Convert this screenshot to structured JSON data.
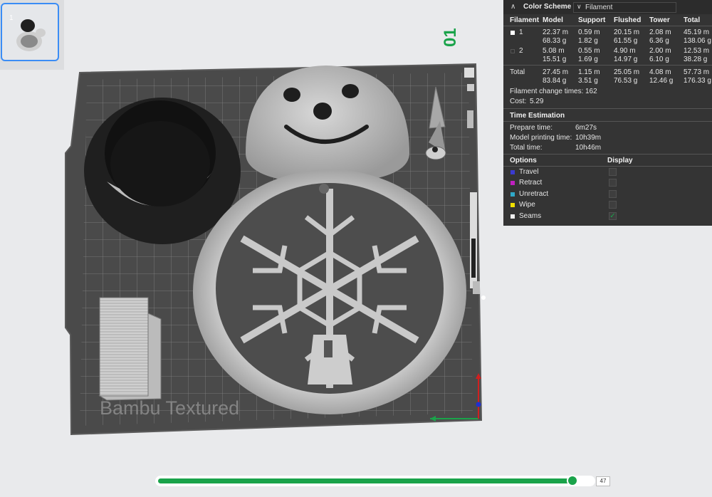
{
  "plate": {
    "thumbnail_index": "1",
    "plate_number": "01",
    "texture_text": "Bambu Textured"
  },
  "stats": {
    "color_scheme_label": "Color Scheme",
    "color_scheme_value": "Filament",
    "headers": [
      "Filament",
      "Model",
      "Support",
      "Flushed",
      "Tower",
      "Total"
    ],
    "rows": [
      {
        "filament": "1",
        "swatch": "#ffffff",
        "model": [
          "22.37 m",
          "68.33 g"
        ],
        "support": [
          "0.59 m",
          "1.82 g"
        ],
        "flushed": [
          "20.15 m",
          "61.55 g"
        ],
        "tower": [
          "2.08 m",
          "6.36 g"
        ],
        "total": [
          "45.19 m",
          "138.06 g"
        ]
      },
      {
        "filament": "2",
        "swatch": "#333333",
        "model": [
          "5.08 m",
          "15.51 g"
        ],
        "support": [
          "0.55 m",
          "1.69 g"
        ],
        "flushed": [
          "4.90 m",
          "14.97 g"
        ],
        "tower": [
          "2.00 m",
          "6.10 g"
        ],
        "total": [
          "12.53 m",
          "38.28 g"
        ]
      }
    ],
    "total_row": {
      "label": "Total",
      "model": [
        "27.45 m",
        "83.84 g"
      ],
      "support": [
        "1.15 m",
        "3.51 g"
      ],
      "flushed": [
        "25.05 m",
        "76.53 g"
      ],
      "tower": [
        "4.08 m",
        "12.46 g"
      ],
      "total": [
        "57.73 m",
        "176.33 g"
      ]
    },
    "filament_change_label": "Filament change times:",
    "filament_change_value": "162",
    "cost_label": "Cost:",
    "cost_value": "5.29",
    "time_title": "Time Estimation",
    "prepare_label": "Prepare time:",
    "prepare_value": "6m27s",
    "model_print_label": "Model printing time:",
    "model_print_value": "10h39m",
    "total_time_label": "Total time:",
    "total_time_value": "10h46m",
    "options_title": "Options",
    "display_title": "Display",
    "options": [
      {
        "label": "Travel",
        "color": "#3b3bd1",
        "checked": false
      },
      {
        "label": "Retract",
        "color": "#c020c0",
        "checked": false
      },
      {
        "label": "Unretract",
        "color": "#2fa8c8",
        "checked": false
      },
      {
        "label": "Wipe",
        "color": "#f0e000",
        "checked": false
      },
      {
        "label": "Seams",
        "color": "#eeeeee",
        "checked": true
      }
    ]
  },
  "slider": {
    "value": "47",
    "fraction": 0.97
  }
}
